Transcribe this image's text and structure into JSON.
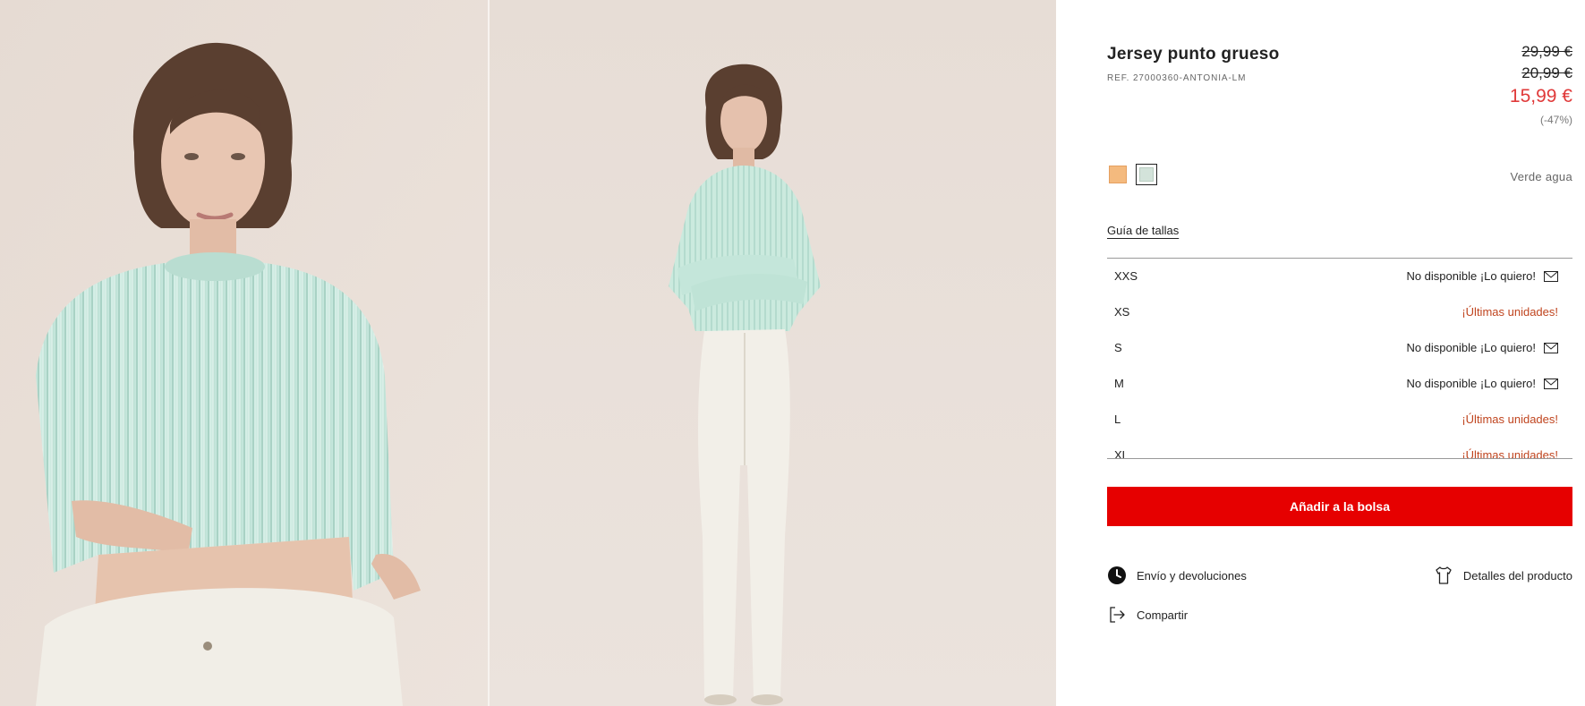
{
  "product": {
    "title": "Jersey punto grueso",
    "ref": "REF. 27000360-ANTONIA-LM",
    "price_original": "29,99 €",
    "price_previous": "20,99 €",
    "price_current": "15,99 €",
    "discount": "(-47%)"
  },
  "colors": {
    "selected_name": "Verde agua",
    "swatches": [
      {
        "name": "orange",
        "hex": "#f4ba7e"
      },
      {
        "name": "verde-agua",
        "hex": "#d3e3da"
      }
    ]
  },
  "size_guide_label": "Guía de tallas",
  "sizes": [
    {
      "label": "XXS",
      "status": "No disponible ¡Lo quiero!",
      "available": false
    },
    {
      "label": "XS",
      "status": "¡Últimas unidades!",
      "available": true
    },
    {
      "label": "S",
      "status": "No disponible ¡Lo quiero!",
      "available": false
    },
    {
      "label": "M",
      "status": "No disponible ¡Lo quiero!",
      "available": false
    },
    {
      "label": "L",
      "status": "¡Últimas unidades!",
      "available": true
    },
    {
      "label": "XL",
      "status": "¡Últimas unidades!",
      "available": true
    }
  ],
  "add_to_bag_label": "Añadir a la bolsa",
  "links": {
    "shipping": "Envío y devoluciones",
    "details": "Detalles del producto",
    "share": "Compartir"
  },
  "theme": {
    "accent_red": "#e60000",
    "price_red": "#e03a3a",
    "low_stock_orange": "#c0451f"
  },
  "icons": {
    "shipping": "clock-icon",
    "details": "tshirt-icon",
    "share": "share-icon",
    "notify": "mail-icon"
  }
}
